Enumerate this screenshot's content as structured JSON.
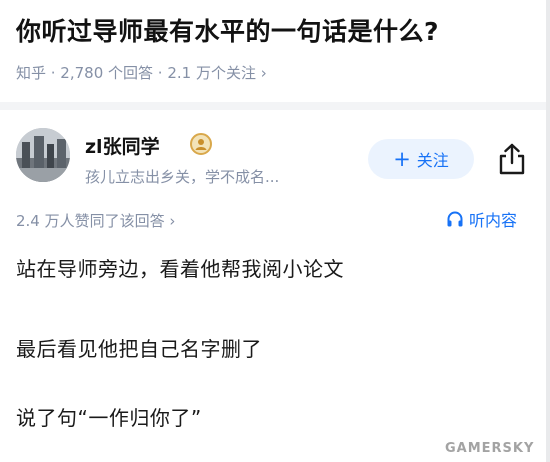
{
  "question": {
    "title": "你听过导师最有水平的一句话是什么?",
    "meta": "知乎 · 2,780 个回答 · 2.1 万个关注 ›"
  },
  "author": {
    "name": "zl张同学",
    "bio": "孩儿立志出乡关，学不成名...",
    "badge_icon": "badge-icon",
    "follow_label": "关注",
    "follow_plus": "+",
    "share_icon": "share-icon"
  },
  "answer_meta": {
    "upvotes": "2.4 万人赞同了该回答 ›",
    "listen_label": "听内容",
    "listen_icon": "headphones-icon"
  },
  "answer": {
    "lines": [
      "站在导师旁边，看着他帮我阅小论文",
      "最后看见他把自己名字删了",
      "说了句“一作归你了”"
    ]
  },
  "watermark": "GAMERSKY",
  "colors": {
    "accent": "#1772f6",
    "meta_gray": "#8590a6",
    "follow_bg": "#ebf3fe"
  }
}
